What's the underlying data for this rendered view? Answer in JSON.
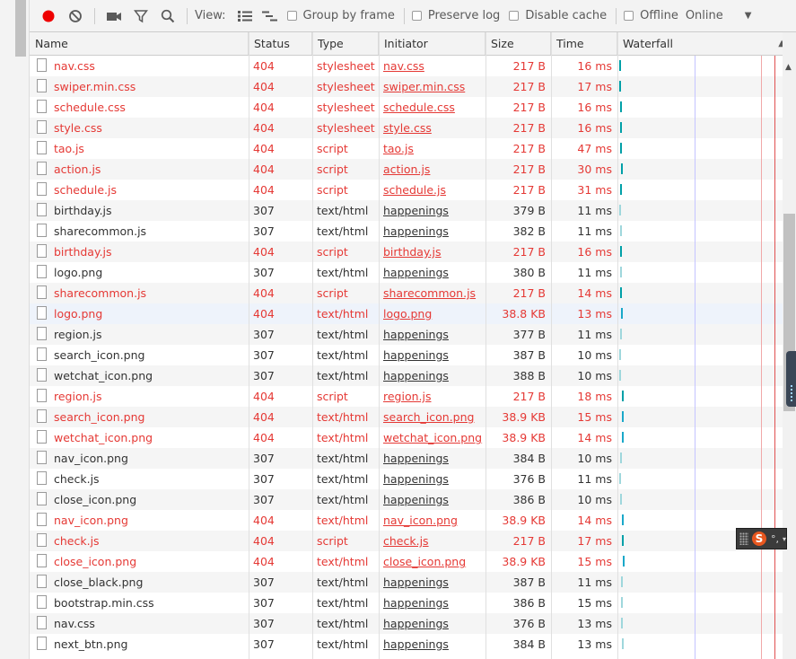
{
  "toolbar": {
    "view_label": "View:",
    "group_by_frame": "Group by frame",
    "preserve_log": "Preserve log",
    "disable_cache": "Disable cache",
    "offline": "Offline",
    "throttle_value": "Online",
    "dropdown_glyph": "▼"
  },
  "colors": {
    "record": "#ee0000",
    "error_text": "#e53935",
    "waterfall_bar": "#00a0a8",
    "dom_content_line": "#7b7bff",
    "load_line": "#e05050"
  },
  "columns": {
    "name": "Name",
    "status": "Status",
    "type": "Type",
    "initiator": "Initiator",
    "size": "Size",
    "time": "Time",
    "waterfall": "Waterfall",
    "sort_glyph": "▲"
  },
  "requests": [
    {
      "name": "nav.css",
      "status": "404",
      "type": "stylesheet",
      "initiator": "nav.css",
      "size": "217 B",
      "time": "16 ms"
    },
    {
      "name": "swiper.min.css",
      "status": "404",
      "type": "stylesheet",
      "initiator": "swiper.min.css",
      "size": "217 B",
      "time": "17 ms"
    },
    {
      "name": "schedule.css",
      "status": "404",
      "type": "stylesheet",
      "initiator": "schedule.css",
      "size": "217 B",
      "time": "16 ms"
    },
    {
      "name": "style.css",
      "status": "404",
      "type": "stylesheet",
      "initiator": "style.css",
      "size": "217 B",
      "time": "16 ms"
    },
    {
      "name": "tao.js",
      "status": "404",
      "type": "script",
      "initiator": "tao.js",
      "size": "217 B",
      "time": "47 ms"
    },
    {
      "name": "action.js",
      "status": "404",
      "type": "script",
      "initiator": "action.js",
      "size": "217 B",
      "time": "30 ms"
    },
    {
      "name": "schedule.js",
      "status": "404",
      "type": "script",
      "initiator": "schedule.js",
      "size": "217 B",
      "time": "31 ms"
    },
    {
      "name": "birthday.js",
      "status": "307",
      "type": "text/html",
      "initiator": "happenings",
      "size": "379 B",
      "time": "11 ms"
    },
    {
      "name": "sharecommon.js",
      "status": "307",
      "type": "text/html",
      "initiator": "happenings",
      "size": "382 B",
      "time": "11 ms"
    },
    {
      "name": "birthday.js",
      "status": "404",
      "type": "script",
      "initiator": "birthday.js",
      "size": "217 B",
      "time": "16 ms"
    },
    {
      "name": "logo.png",
      "status": "307",
      "type": "text/html",
      "initiator": "happenings",
      "size": "380 B",
      "time": "11 ms"
    },
    {
      "name": "sharecommon.js",
      "status": "404",
      "type": "script",
      "initiator": "sharecommon.js",
      "size": "217 B",
      "time": "14 ms"
    },
    {
      "name": "logo.png",
      "status": "404",
      "type": "text/html",
      "initiator": "logo.png",
      "size": "38.8 KB",
      "time": "13 ms"
    },
    {
      "name": "region.js",
      "status": "307",
      "type": "text/html",
      "initiator": "happenings",
      "size": "377 B",
      "time": "11 ms"
    },
    {
      "name": "search_icon.png",
      "status": "307",
      "type": "text/html",
      "initiator": "happenings",
      "size": "387 B",
      "time": "10 ms"
    },
    {
      "name": "wetchat_icon.png",
      "status": "307",
      "type": "text/html",
      "initiator": "happenings",
      "size": "388 B",
      "time": "10 ms"
    },
    {
      "name": "region.js",
      "status": "404",
      "type": "script",
      "initiator": "region.js",
      "size": "217 B",
      "time": "18 ms"
    },
    {
      "name": "search_icon.png",
      "status": "404",
      "type": "text/html",
      "initiator": "search_icon.png",
      "size": "38.9 KB",
      "time": "15 ms"
    },
    {
      "name": "wetchat_icon.png",
      "status": "404",
      "type": "text/html",
      "initiator": "wetchat_icon.png",
      "size": "38.9 KB",
      "time": "14 ms"
    },
    {
      "name": "nav_icon.png",
      "status": "307",
      "type": "text/html",
      "initiator": "happenings",
      "size": "384 B",
      "time": "10 ms"
    },
    {
      "name": "check.js",
      "status": "307",
      "type": "text/html",
      "initiator": "happenings",
      "size": "376 B",
      "time": "11 ms"
    },
    {
      "name": "close_icon.png",
      "status": "307",
      "type": "text/html",
      "initiator": "happenings",
      "size": "386 B",
      "time": "10 ms"
    },
    {
      "name": "nav_icon.png",
      "status": "404",
      "type": "text/html",
      "initiator": "nav_icon.png",
      "size": "38.9 KB",
      "time": "14 ms"
    },
    {
      "name": "check.js",
      "status": "404",
      "type": "script",
      "initiator": "check.js",
      "size": "217 B",
      "time": "17 ms"
    },
    {
      "name": "close_icon.png",
      "status": "404",
      "type": "text/html",
      "initiator": "close_icon.png",
      "size": "38.9 KB",
      "time": "15 ms"
    },
    {
      "name": "close_black.png",
      "status": "307",
      "type": "text/html",
      "initiator": "happenings",
      "size": "387 B",
      "time": "11 ms"
    },
    {
      "name": "bootstrap.min.css",
      "status": "307",
      "type": "text/html",
      "initiator": "happenings",
      "size": "386 B",
      "time": "15 ms"
    },
    {
      "name": "nav.css",
      "status": "307",
      "type": "text/html",
      "initiator": "happenings",
      "size": "376 B",
      "time": "13 ms"
    },
    {
      "name": "next_btn.png",
      "status": "307",
      "type": "text/html",
      "initiator": "happenings",
      "size": "384 B",
      "time": "13 ms"
    }
  ],
  "ime": {
    "logo_letter": "S",
    "mark": "°,"
  }
}
